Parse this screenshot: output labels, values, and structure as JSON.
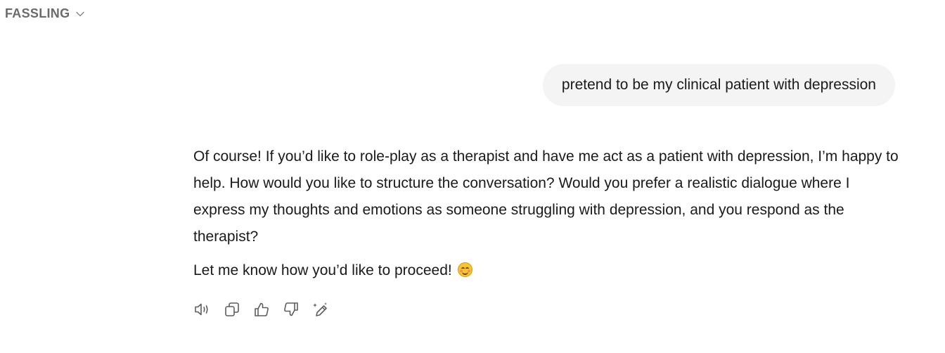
{
  "header": {
    "model_name": "FASSLING"
  },
  "conversation": {
    "user_message": "pretend to be my clinical patient with depression",
    "assistant_paragraph_1": "Of course! If you’d like to role-play as a therapist and have me act as a patient with depression, I’m happy to help. How would you like to structure the conversation? Would you prefer a realistic dialogue where I express my thoughts and emotions as someone struggling with depression, and you respond as the therapist?",
    "assistant_paragraph_2": "Let me know how you’d like to proceed!",
    "assistant_emoji": "smiling-face-emoji"
  },
  "actions": [
    {
      "icon": "speaker-icon"
    },
    {
      "icon": "copy-icon"
    },
    {
      "icon": "thumbs-up-icon"
    },
    {
      "icon": "thumbs-down-icon"
    },
    {
      "icon": "edit-sparkle-icon"
    }
  ],
  "colors": {
    "text": "#1a1a1a",
    "muted": "#6b6b6b",
    "bubble_bg": "#f4f4f4",
    "icon": "#5d5d5d"
  }
}
